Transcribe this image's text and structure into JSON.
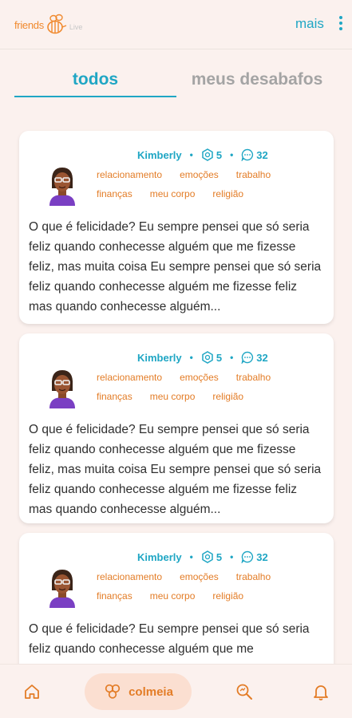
{
  "app": {
    "logo_text": "friends",
    "logo_suffix": "Live",
    "menu_label": "mais"
  },
  "tabs": [
    {
      "label": "todos",
      "active": true
    },
    {
      "label": "meus desabafos",
      "active": false
    }
  ],
  "posts": [
    {
      "author": "Kimberly",
      "stat_hex": "5",
      "stat_comments": "32",
      "tags": [
        "relacionamento",
        "emoções",
        "trabalho",
        "finanças",
        "meu corpo",
        "religião"
      ],
      "text": "O que é felicidade? Eu sempre pensei que só seria feliz quando conhecesse alguém que me fizesse feliz, mas muita coisa Eu sempre pensei que só seria feliz quando conhecesse alguém me fizesse feliz mas quando conhecesse alguém..."
    },
    {
      "author": "Kimberly",
      "stat_hex": "5",
      "stat_comments": "32",
      "tags": [
        "relacionamento",
        "emoções",
        "trabalho",
        "finanças",
        "meu corpo",
        "religião"
      ],
      "text": "O que é felicidade? Eu sempre pensei que só seria feliz quando conhecesse alguém que me fizesse feliz, mas muita coisa Eu sempre pensei que só seria feliz quando conhecesse alguém me fizesse feliz mas quando conhecesse alguém..."
    },
    {
      "author": "Kimberly",
      "stat_hex": "5",
      "stat_comments": "32",
      "tags": [
        "relacionamento",
        "emoções",
        "trabalho",
        "finanças",
        "meu corpo",
        "religião"
      ],
      "text": "O que é felicidade? Eu sempre pensei que só seria feliz quando conhecesse alguém que me"
    }
  ],
  "bottom_nav": {
    "active_label": "colmeia",
    "icons": [
      "home-icon",
      "hive-icon",
      "search-icon",
      "bell-icon"
    ]
  },
  "colors": {
    "accent_blue": "#1fa6c4",
    "accent_orange": "#e37c26",
    "background": "#fbf1ee"
  }
}
